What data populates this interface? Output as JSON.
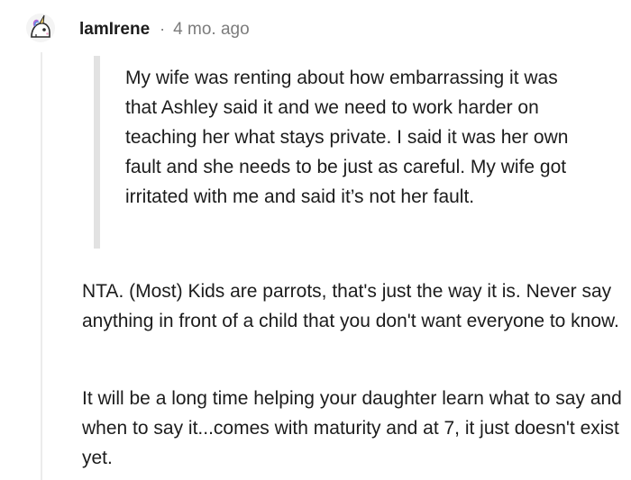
{
  "comment": {
    "author": "lamIrene",
    "separator": "·",
    "timestamp": "4 mo. ago",
    "avatar_icon": "unicorn-avatar-icon",
    "quote": "My wife was renting about how embarrassing it was that Ashley said it and we need to work harder on teaching her what stays private. I said it was her own fault and she needs to be just as careful. My wife got irritated with me and said it’s not her fault.",
    "paragraphs": [
      "NTA. (Most) Kids are parrots, that's just the way it is. Never say anything in front of a child that you don't want everyone to know.",
      "It will be a long time helping your daughter learn what to say and when to say it...comes with maturity and at 7, it just doesn't exist yet."
    ]
  },
  "colors": {
    "text": "#1c1c1c",
    "meta": "#7c7c7c",
    "quote_bar": "#e2e2e2",
    "thread_line": "#ececec"
  }
}
